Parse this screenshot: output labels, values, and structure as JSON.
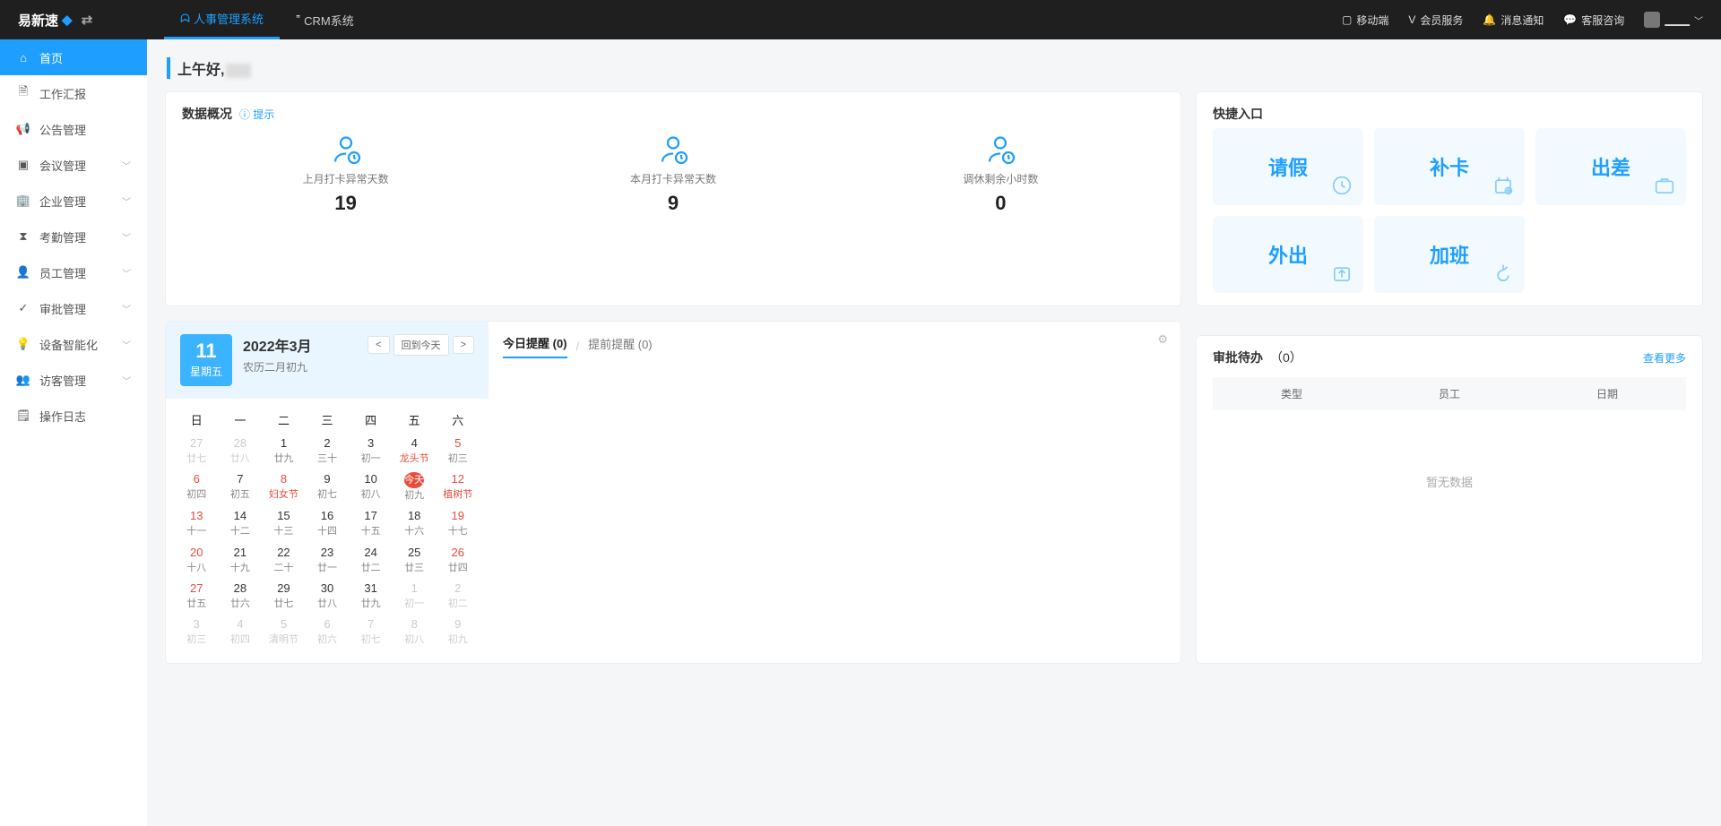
{
  "brand": "易新速",
  "topnav": [
    {
      "label": "人事管理系统",
      "active": true
    },
    {
      "label": "CRM系统",
      "active": false
    }
  ],
  "topright": {
    "mobile": "移动端",
    "member": "会员服务",
    "notice": "消息通知",
    "service": "客服咨询",
    "user": "▁▁▁"
  },
  "sidebar": [
    {
      "label": "首页",
      "arrow": false,
      "active": true,
      "icon": "home"
    },
    {
      "label": "工作汇报",
      "arrow": false,
      "icon": "doc"
    },
    {
      "label": "公告管理",
      "arrow": false,
      "icon": "horn"
    },
    {
      "label": "会议管理",
      "arrow": true,
      "icon": "meeting"
    },
    {
      "label": "企业管理",
      "arrow": true,
      "icon": "org"
    },
    {
      "label": "考勤管理",
      "arrow": true,
      "icon": "clock"
    },
    {
      "label": "员工管理",
      "arrow": true,
      "icon": "staff"
    },
    {
      "label": "审批管理",
      "arrow": true,
      "icon": "approve"
    },
    {
      "label": "设备智能化",
      "arrow": true,
      "icon": "device"
    },
    {
      "label": "访客管理",
      "arrow": true,
      "icon": "visitor"
    },
    {
      "label": "操作日志",
      "arrow": false,
      "icon": "log"
    }
  ],
  "greeting": "上午好,",
  "overview": {
    "title": "数据概况",
    "hint": "提示",
    "stats": [
      {
        "label": "上月打卡异常天数",
        "value": "19"
      },
      {
        "label": "本月打卡异常天数",
        "value": "9"
      },
      {
        "label": "调休剩余小时数",
        "value": "0"
      }
    ]
  },
  "quick": {
    "title": "快捷入口",
    "cells": [
      {
        "label": "请假"
      },
      {
        "label": "补卡"
      },
      {
        "label": "出差"
      },
      {
        "label": "外出"
      },
      {
        "label": "加班"
      }
    ]
  },
  "calendar": {
    "dayNum": "11",
    "dayName": "星期五",
    "month": "2022年3月",
    "lunar": "农历二月初九",
    "today": "回到今天",
    "dow": [
      "日",
      "一",
      "二",
      "三",
      "四",
      "五",
      "六"
    ],
    "weeks": [
      [
        {
          "n": "27",
          "s": "廿七",
          "dim": true
        },
        {
          "n": "28",
          "s": "廿八",
          "dim": true
        },
        {
          "n": "1",
          "s": "廿九"
        },
        {
          "n": "2",
          "s": "三十"
        },
        {
          "n": "3",
          "s": "初一"
        },
        {
          "n": "4",
          "s": "龙头节",
          "fest": true
        },
        {
          "n": "5",
          "s": "初三",
          "we": true
        }
      ],
      [
        {
          "n": "6",
          "s": "初四",
          "we": true
        },
        {
          "n": "7",
          "s": "初五"
        },
        {
          "n": "8",
          "s": "妇女节",
          "fest": true,
          "we": true
        },
        {
          "n": "9",
          "s": "初七"
        },
        {
          "n": "10",
          "s": "初八"
        },
        {
          "n": "今天",
          "s": "初九",
          "today": true
        },
        {
          "n": "12",
          "s": "植树节",
          "we": true,
          "fest": true
        }
      ],
      [
        {
          "n": "13",
          "s": "十一",
          "we": true
        },
        {
          "n": "14",
          "s": "十二"
        },
        {
          "n": "15",
          "s": "十三"
        },
        {
          "n": "16",
          "s": "十四"
        },
        {
          "n": "17",
          "s": "十五"
        },
        {
          "n": "18",
          "s": "十六"
        },
        {
          "n": "19",
          "s": "十七",
          "we": true
        }
      ],
      [
        {
          "n": "20",
          "s": "十八",
          "we": true
        },
        {
          "n": "21",
          "s": "十九"
        },
        {
          "n": "22",
          "s": "二十"
        },
        {
          "n": "23",
          "s": "廿一"
        },
        {
          "n": "24",
          "s": "廿二"
        },
        {
          "n": "25",
          "s": "廿三"
        },
        {
          "n": "26",
          "s": "廿四",
          "we": true
        }
      ],
      [
        {
          "n": "27",
          "s": "廿五",
          "we": true
        },
        {
          "n": "28",
          "s": "廿六"
        },
        {
          "n": "29",
          "s": "廿七"
        },
        {
          "n": "30",
          "s": "廿八"
        },
        {
          "n": "31",
          "s": "廿九"
        },
        {
          "n": "1",
          "s": "初一",
          "dim": true
        },
        {
          "n": "2",
          "s": "初二",
          "dim": true
        }
      ],
      [
        {
          "n": "3",
          "s": "初三",
          "dim": true
        },
        {
          "n": "4",
          "s": "初四",
          "dim": true
        },
        {
          "n": "5",
          "s": "清明节",
          "dim": true
        },
        {
          "n": "6",
          "s": "初六",
          "dim": true
        },
        {
          "n": "7",
          "s": "初七",
          "dim": true
        },
        {
          "n": "8",
          "s": "初八",
          "dim": true
        },
        {
          "n": "9",
          "s": "初九",
          "dim": true
        }
      ]
    ]
  },
  "reminders": {
    "tab1": "今日提醒 (0)",
    "tab2": "提前提醒 (0)"
  },
  "approval": {
    "title": "审批待办",
    "count": "（0）",
    "more": "查看更多",
    "cols": [
      "类型",
      "员工",
      "日期"
    ],
    "empty": "暂无数据"
  }
}
